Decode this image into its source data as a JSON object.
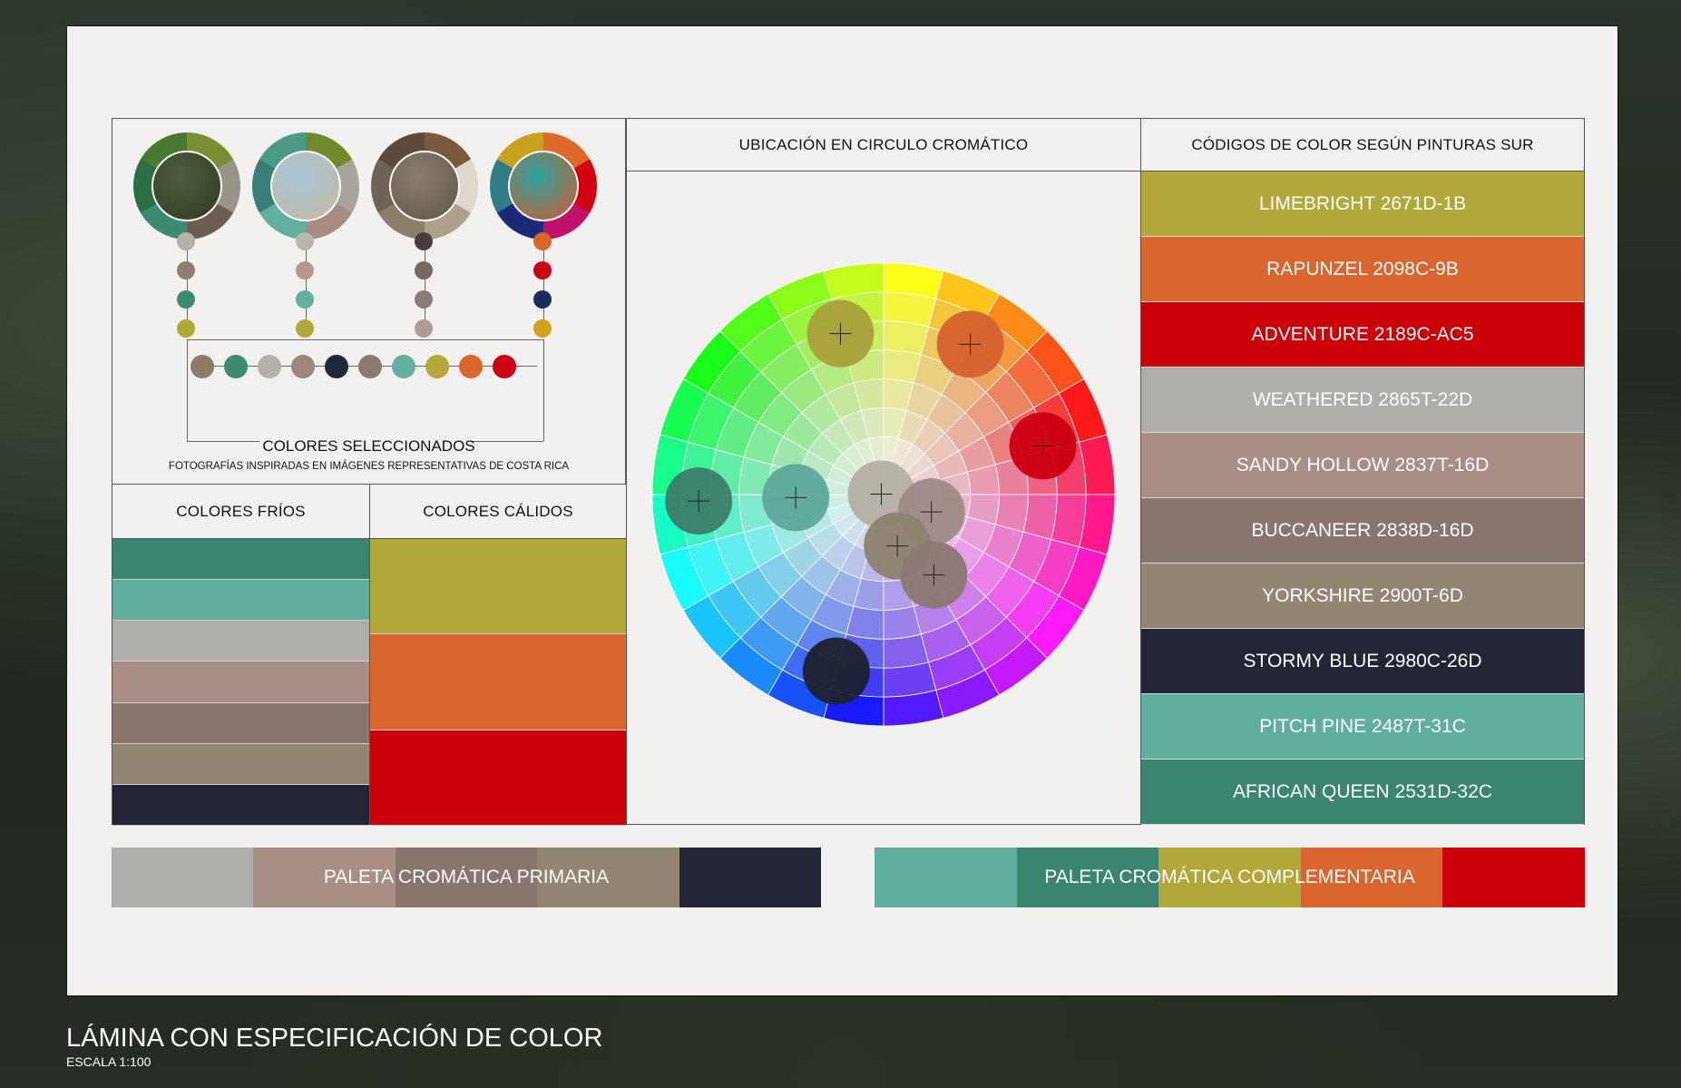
{
  "title": "LÁMINA CON ESPECIFICACIÓN DE COLOR",
  "subtitle": "ESCALA 1:100",
  "selected": {
    "label": "COLORES SELECCIONADOS",
    "caption": "FOTOGRAFÍAS INSPIRADAS EN IMÁGENES REPRESENTATIVAS DE COSTA RICA",
    "photos": [
      {
        "name": "forest",
        "ring": [
          "#7a8d33",
          "#9a9389",
          "#6b5d53",
          "#3c8a70",
          "#2c6e44",
          "#4a7a2e"
        ],
        "center": [
          "#4f5e3a",
          "#2d3a24"
        ],
        "dots": [
          "#b3b1a8",
          "#8e8070",
          "#3c8a70",
          "#b2a83a"
        ]
      },
      {
        "name": "beach",
        "ring": [
          "#6f8a2c",
          "#a8a49a",
          "#a88c84",
          "#63b0a1",
          "#3b7e79",
          "#4a9a86"
        ],
        "center": [
          "#a7c4d8",
          "#c6b9a0"
        ],
        "dots": [
          "#b9b6ae",
          "#b9978c",
          "#63b0a1",
          "#b2a83a"
        ]
      },
      {
        "name": "bark",
        "ring": [
          "#7a5a3c",
          "#ded8cd",
          "#aea18c",
          "#8d7e6c",
          "#6f6358",
          "#5d4a3a"
        ],
        "center": [
          "#8a7f6d",
          "#5f564a"
        ],
        "dots": [
          "#4a3f38",
          "#77685f",
          "#8e7a78",
          "#b09a95"
        ]
      },
      {
        "name": "mandala",
        "ring": [
          "#dd6a2a",
          "#d40014",
          "#bf126b",
          "#1c2a75",
          "#2e7c85",
          "#c7a21f"
        ],
        "center": [
          "#2ba3a0",
          "#d25a2a"
        ],
        "dots": [
          "#d9662a",
          "#cc0014",
          "#1e2a5c",
          "#d1a21c"
        ]
      }
    ],
    "row": [
      "#8c7b68",
      "#3c8a70",
      "#b3b1a8",
      "#9e8580",
      "#22263a",
      "#8a7a72",
      "#63b0a1",
      "#b2a83a",
      "#d9662a",
      "#cc0014"
    ]
  },
  "wheel": {
    "header": "UBICACIÓN EN CIRCULO CROMÁTICO",
    "markers": [
      {
        "name": "limebright",
        "hue": 345,
        "radius": 0.72,
        "color": "#a9a03c"
      },
      {
        "name": "rapunzel",
        "hue": 30,
        "radius": 0.75,
        "color": "#d4632f"
      },
      {
        "name": "adventure",
        "hue": 73,
        "radius": 0.72,
        "color": "#cc0014"
      },
      {
        "name": "african-queen",
        "hue": 268,
        "radius": 0.8,
        "color": "#3c7f6b"
      },
      {
        "name": "pitch-pine",
        "hue": 268,
        "radius": 0.38,
        "color": "#5fa99b"
      },
      {
        "name": "weathered",
        "hue": 282,
        "radius": 0.01,
        "color": "#b5b0a5"
      },
      {
        "name": "sandy-hollow",
        "hue": 110,
        "radius": 0.22,
        "color": "#a08a86"
      },
      {
        "name": "yorkshire",
        "hue": 165,
        "radius": 0.23,
        "color": "#8e826f"
      },
      {
        "name": "buccaneer",
        "hue": 148,
        "radius": 0.41,
        "color": "#8d7872"
      },
      {
        "name": "stormy-blue",
        "hue": 195,
        "radius": 0.79,
        "color": "#1d2130"
      }
    ]
  },
  "codes": {
    "header": "CÓDIGOS DE COLOR SEGÚN PINTURAS SUR",
    "rows": [
      {
        "label": "LIMEBRIGHT 2671D-1B",
        "color": "#b2a83a"
      },
      {
        "label": "RAPUNZEL 2098C-9B",
        "color": "#d9662f"
      },
      {
        "label": "ADVENTURE 2189C-AC5",
        "color": "#cc0008"
      },
      {
        "label": "WEATHERED 2865T-22D",
        "color": "#b0aeab"
      },
      {
        "label": "SANDY HOLLOW 2837T-16D",
        "color": "#a98e86"
      },
      {
        "label": "BUCCANEER 2838D-16D",
        "color": "#8a746e"
      },
      {
        "label": "YORKSHIRE 2900T-6D",
        "color": "#928572"
      },
      {
        "label": "STORMY BLUE 2980C-26D",
        "color": "#222535"
      },
      {
        "label": "PITCH PINE 2487T-31C",
        "color": "#60ae9e"
      },
      {
        "label": "AFRICAN QUEEN 2531D-32C",
        "color": "#3b8470"
      }
    ]
  },
  "cold": {
    "header": "COLORES FRÍOS",
    "stripes": [
      "#3b8470",
      "#60ae9e",
      "#b0aeab",
      "#a98e86",
      "#8a746e",
      "#928572",
      "#222535"
    ]
  },
  "warm": {
    "header": "COLORES CÁLIDOS",
    "stripes": [
      "#b2a83a",
      "#d9662f",
      "#cc0008"
    ]
  },
  "primary": {
    "label": "PALETA CROMÁTICA PRIMARIA",
    "colors": [
      "#b0aeab",
      "#a98e86",
      "#8a746e",
      "#928572",
      "#222535"
    ]
  },
  "complementary": {
    "label": "PALETA CROMÁTICA COMPLEMENTARIA",
    "colors": [
      "#60ae9e",
      "#3b8470",
      "#b2a83a",
      "#d9662f",
      "#cc0008"
    ]
  }
}
